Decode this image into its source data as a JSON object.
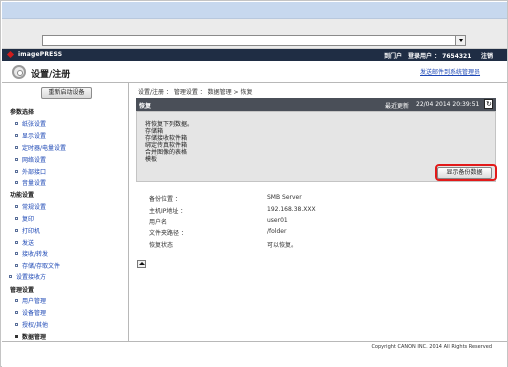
{
  "brand": {
    "product": "imagePRESS",
    "portal": "到门户",
    "user": "登录用户 ： 7654321",
    "logout": "注销"
  },
  "header": {
    "title": "设置/注册",
    "mail_link": "发送邮件到系统管理员"
  },
  "sidebar": {
    "restart_button": "重新启动设备",
    "categories": [
      {
        "label": "参数选择",
        "items": [
          "纸张设置",
          "显示设置",
          "定时器/电量设置",
          "网络设置",
          "外部接口",
          "音量设置"
        ]
      },
      {
        "label": "功能设置",
        "items": [
          "常规设置",
          "复印",
          "打印机",
          "发送",
          "接收/转发",
          "存储/存取文件"
        ]
      },
      {
        "label": "设置接收方",
        "items": []
      },
      {
        "label": "管理设置",
        "items": [
          "用户管理",
          "设备管理",
          "授权/其他",
          "数据管理"
        ]
      }
    ]
  },
  "main": {
    "breadcrumb": "设置/注册 ： 管理设置 ： 数据管理 > 恢复",
    "panel": {
      "title": "恢复",
      "update_label": "最近更新",
      "update_time": "22/04 2014 20:39:51",
      "lines": [
        "将恢复下列数据。",
        "存储箱",
        "存储接收软件箱",
        "绑定传真软件箱",
        "合并图像的表格",
        "模板"
      ],
      "restore_button": "显示备份数据"
    },
    "info": [
      {
        "label": "备份位置 ：",
        "value": "SMB Server"
      },
      {
        "label": "主机IP地址 ：",
        "value": "192.168.38.XXX"
      },
      {
        "label": "用户名",
        "value": "user01"
      },
      {
        "label": "文件夹路径 ：",
        "value": "/folder"
      },
      {
        "label": "恢复状态",
        "value": "可以恢复。"
      }
    ]
  },
  "footer": {
    "copyright": "Copyright CANON INC. 2014 All Rights Reserved"
  }
}
